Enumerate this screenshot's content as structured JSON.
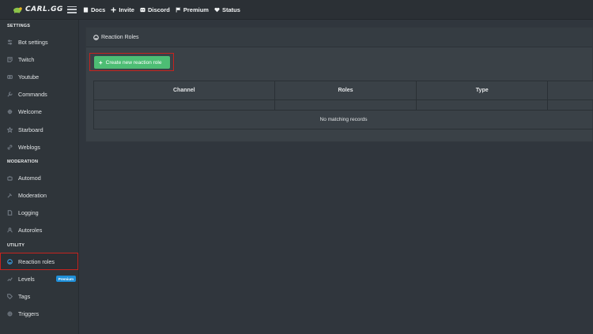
{
  "brand": {
    "name": "CARL.GG"
  },
  "topnav": [
    {
      "label": "Docs",
      "icon": "book-icon"
    },
    {
      "label": "Invite",
      "icon": "plus-icon"
    },
    {
      "label": "Discord",
      "icon": "discord-icon"
    },
    {
      "label": "Premium",
      "icon": "flag-icon"
    },
    {
      "label": "Status",
      "icon": "heart-icon"
    }
  ],
  "sidebar": {
    "sections": [
      {
        "title": "SETTINGS",
        "items": [
          {
            "label": "Bot settings",
            "icon": "sliders-icon"
          },
          {
            "label": "Twitch",
            "icon": "twitch-icon"
          },
          {
            "label": "Youtube",
            "icon": "youtube-icon"
          },
          {
            "label": "Commands",
            "icon": "wrench-icon"
          },
          {
            "label": "Welcome",
            "icon": "door-icon"
          },
          {
            "label": "Starboard",
            "icon": "star-icon"
          },
          {
            "label": "Weblogs",
            "icon": "link-icon"
          }
        ]
      },
      {
        "title": "MODERATION",
        "items": [
          {
            "label": "Automod",
            "icon": "robot-icon"
          },
          {
            "label": "Moderation",
            "icon": "hammer-icon"
          },
          {
            "label": "Logging",
            "icon": "file-icon"
          },
          {
            "label": "Autoroles",
            "icon": "users-icon"
          }
        ]
      },
      {
        "title": "UTILITY",
        "items": [
          {
            "label": "Reaction roles",
            "icon": "smile-icon",
            "active": true
          },
          {
            "label": "Levels",
            "icon": "levels-icon",
            "badge": "Premium"
          },
          {
            "label": "Tags",
            "icon": "tag-icon"
          },
          {
            "label": "Triggers",
            "icon": "trigger-icon"
          }
        ]
      }
    ]
  },
  "main": {
    "card_title": "Reaction Roles",
    "create_button": "Create new reaction role",
    "table": {
      "columns": [
        "Channel",
        "Roles",
        "Type",
        ""
      ],
      "empty_text": "No matching records"
    }
  },
  "colors": {
    "accent_green": "#4dbd74",
    "highlight_red": "#c6231f",
    "badge_blue": "#1f8fd8"
  }
}
